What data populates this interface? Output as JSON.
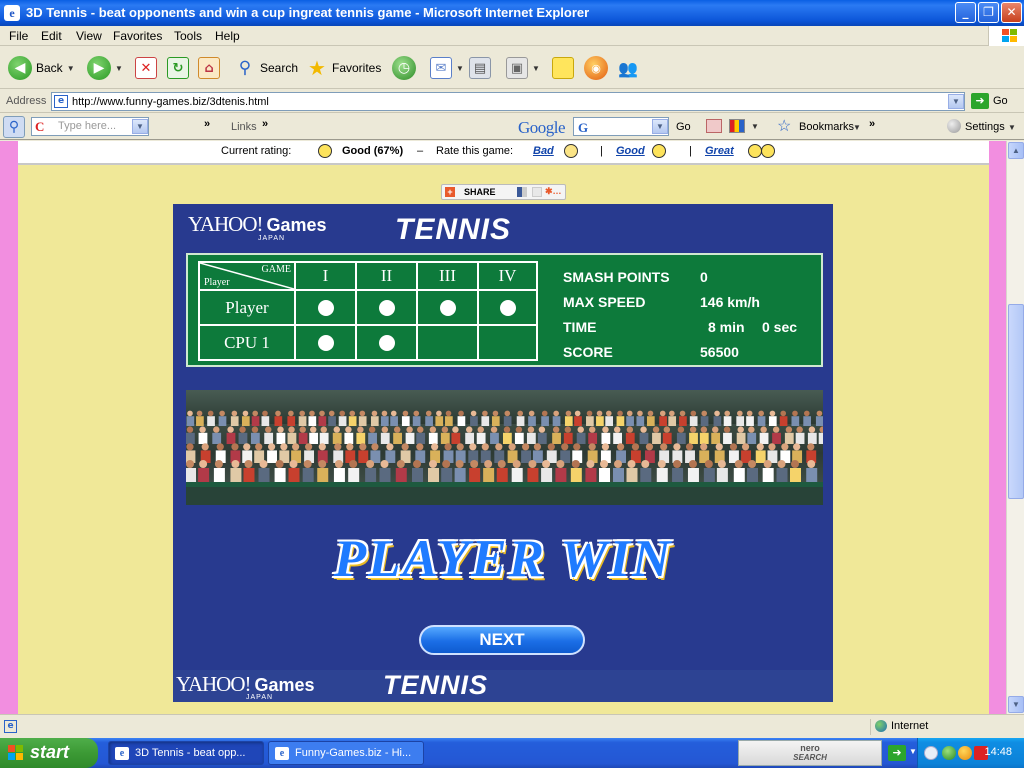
{
  "window": {
    "title": "3D Tennis - beat opponents and win a cup ingreat tennis game - Microsoft Internet Explorer",
    "minimize": "_",
    "maximize": "❐",
    "close": "✕"
  },
  "menu": [
    "File",
    "Edit",
    "View",
    "Favorites",
    "Tools",
    "Help"
  ],
  "toolbar": {
    "back": "Back",
    "search": "Search",
    "favorites": "Favorites"
  },
  "address": {
    "label": "Address",
    "url": "http://www.funny-games.biz/3dtenis.html",
    "go": "Go"
  },
  "googlebar": {
    "search_placeholder": "Type here...",
    "links": "Links",
    "google": "Google",
    "go": "Go",
    "bookmarks": "Bookmarks",
    "settings": "Settings"
  },
  "rating": {
    "current_label": "Current rating:",
    "current_value": "Good (67%)",
    "rate_label": "Rate this game:",
    "bad": "Bad",
    "good": "Good",
    "great": "Great"
  },
  "share": {
    "label": "SHARE"
  },
  "game": {
    "logo_yahoo": "YAHOO!",
    "logo_japan": "JAPAN",
    "logo_games": "Games",
    "title": "TENNIS",
    "scoreboard": {
      "header_game": "GAME",
      "header_player": "Player",
      "games": [
        "I",
        "II",
        "III",
        "IV"
      ],
      "rows": [
        {
          "name": "Player",
          "wins": [
            true,
            true,
            true,
            true
          ]
        },
        {
          "name": "CPU 1",
          "wins": [
            true,
            true,
            false,
            false
          ]
        }
      ]
    },
    "stats": [
      {
        "label": "SMASH POINTS",
        "value": "0"
      },
      {
        "label": "MAX SPEED",
        "value": "146 km/h"
      },
      {
        "label": "TIME",
        "min": "8 min",
        "sec": "0 sec"
      },
      {
        "label": "SCORE",
        "value": "56500"
      }
    ],
    "result": "PLAYER WIN",
    "next_button": "NEXT"
  },
  "status": {
    "zone": "Internet"
  },
  "taskbar": {
    "start": "start",
    "tasks": [
      "3D Tennis - beat opp...",
      "Funny-Games.biz - Hi..."
    ],
    "nero_top": "nero",
    "nero_bottom": "SEARCH",
    "clock": "14:48"
  },
  "colors": {
    "game_bg": "#283a8f",
    "scoreboard_green": "#0d7a3b",
    "page_bg": "#f0e898",
    "page_side": "#f28ee0",
    "win_text": "#1f7bff"
  }
}
